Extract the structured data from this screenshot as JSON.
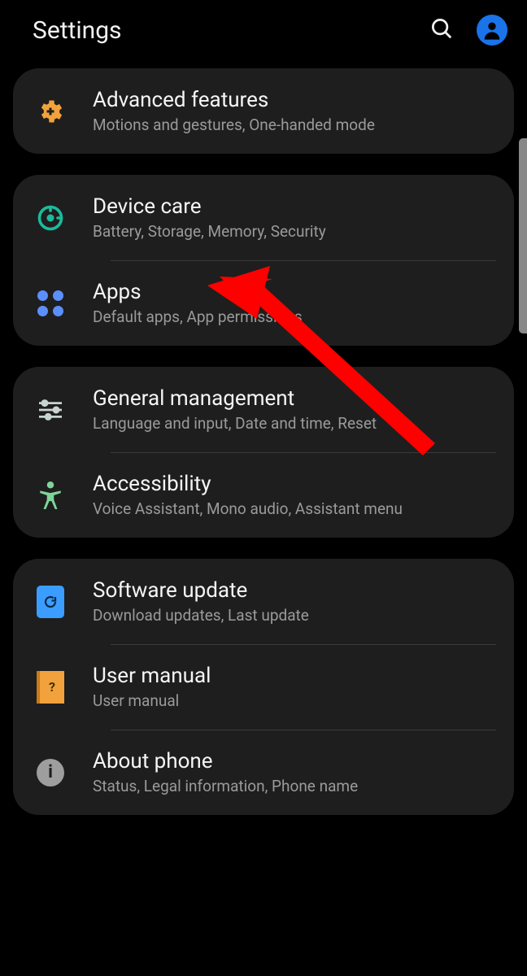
{
  "header": {
    "title": "Settings"
  },
  "groups": [
    {
      "items": [
        {
          "icon": "advanced",
          "title": "Advanced features",
          "sub": "Motions and gestures, One-handed mode"
        }
      ]
    },
    {
      "items": [
        {
          "icon": "devicecare",
          "title": "Device care",
          "sub": "Battery, Storage, Memory, Security"
        },
        {
          "icon": "apps",
          "title": "Apps",
          "sub": "Default apps, App permissions"
        }
      ]
    },
    {
      "items": [
        {
          "icon": "general",
          "title": "General management",
          "sub": "Language and input, Date and time, Reset"
        },
        {
          "icon": "accessibility",
          "title": "Accessibility",
          "sub": "Voice Assistant, Mono audio, Assistant menu"
        }
      ]
    },
    {
      "items": [
        {
          "icon": "update",
          "title": "Software update",
          "sub": "Download updates, Last update"
        },
        {
          "icon": "manual",
          "title": "User manual",
          "sub": "User manual"
        },
        {
          "icon": "about",
          "title": "About phone",
          "sub": "Status, Legal information, Phone name"
        }
      ]
    }
  ],
  "annotation": {
    "arrow_target": "Device care",
    "arrow_color": "#ff0000"
  }
}
